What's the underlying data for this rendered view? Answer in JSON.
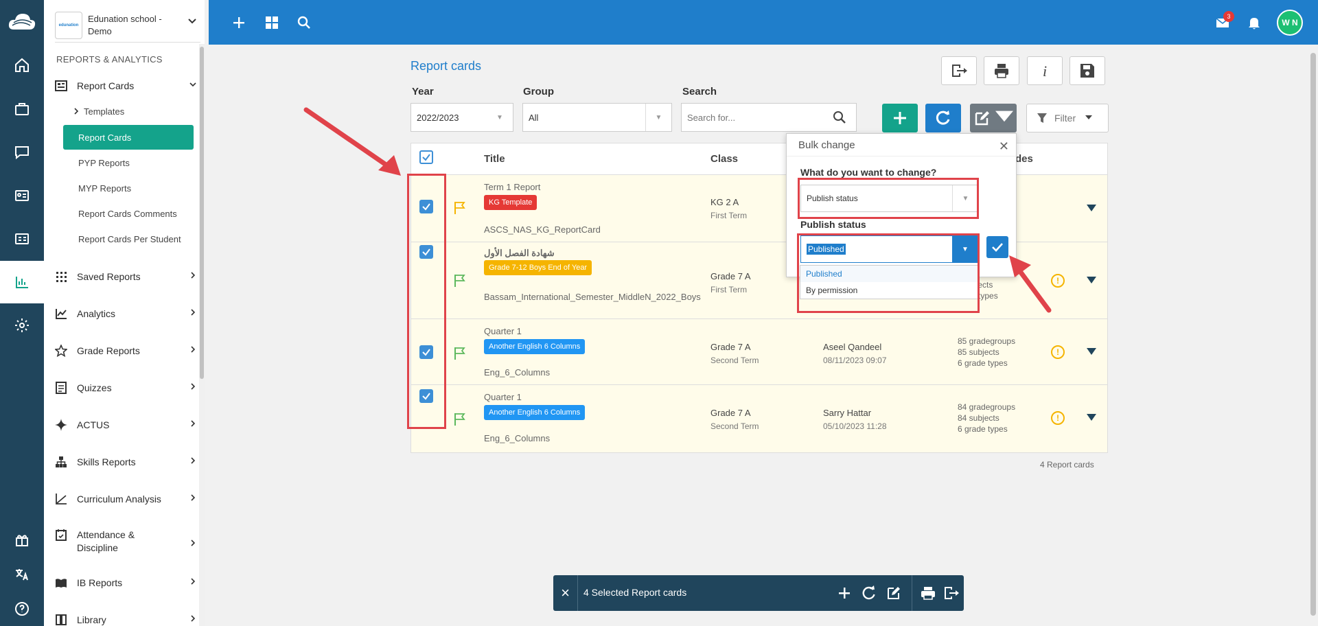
{
  "app": {
    "school_name": "Edunation school - Demo",
    "school_logo_text": "edunation"
  },
  "topbar": {
    "mail_count": "3",
    "avatar_initials": "W N"
  },
  "sidebar": {
    "section_heading": "REPORTS & ANALYTICS",
    "report_cards_label": "Report Cards",
    "sub_items": [
      "Templates",
      "Report Cards",
      "PYP Reports",
      "MYP Reports",
      "Report Cards Comments",
      "Report Cards Per Student"
    ],
    "main_items": [
      "Saved Reports",
      "Analytics",
      "Grade Reports",
      "Quizzes",
      "ACTUS",
      "Skills Reports",
      "Curriculum Analysis",
      "Attendance & Discipline",
      "IB Reports",
      "Library"
    ]
  },
  "page": {
    "title": "Report cards",
    "year_label": "Year",
    "year_value": "2022/2023",
    "group_label": "Group",
    "group_value": "All",
    "search_label": "Search",
    "search_placeholder": "Search for...",
    "filter_label": "Filter",
    "count_text": "4 Report cards"
  },
  "table": {
    "headers": {
      "title": "Title",
      "class": "Class",
      "partial": "des"
    },
    "rows": [
      {
        "title": "Term 1 Report",
        "tag": "KG Template",
        "code": "ASCS_NAS_KG_ReportCard",
        "class": "KG 2 A",
        "term": "First Term",
        "user": "",
        "date": "",
        "stats": [
          "",
          "",
          ""
        ]
      },
      {
        "title": "شهادة الفصل الأول",
        "tag": "Grade 7-12 Boys End of Year",
        "code": "Bassam_International_Semester_MiddleN_2022_Boys",
        "class": "Grade 7 A",
        "term": "First Term",
        "user": "",
        "date": "",
        "stats": [
          "bjects",
          "e types"
        ]
      },
      {
        "title": "Quarter 1",
        "tag": "Another English 6 Columns",
        "code": "Eng_6_Columns",
        "class": "Grade 7 A",
        "term": "Second Term",
        "user": "Aseel Qandeel",
        "date": "08/11/2023 09:07",
        "stats": [
          "85 gradegroups",
          "85 subjects",
          "6 grade types"
        ]
      },
      {
        "title": "Quarter 1",
        "tag": "Another English 6 Columns",
        "code": "Eng_6_Columns",
        "class": "Grade 7 A",
        "term": "Second Term",
        "user": "Sarry Hattar",
        "date": "05/10/2023 11:28",
        "stats": [
          "84 gradegroups",
          "84 subjects",
          "6 grade types"
        ]
      }
    ]
  },
  "bulk": {
    "title": "Bulk change",
    "question": "What do you want to change?",
    "field_value": "Publish status",
    "status_label": "Publish status",
    "status_value": "Published",
    "options": [
      "Published",
      "By permission"
    ]
  },
  "selection_bar": {
    "text": "4 Selected Report cards"
  },
  "colors": {
    "accent": "#1f7ecb",
    "teal": "#14a38b",
    "navy": "#20455c",
    "red": "#e0434a"
  }
}
